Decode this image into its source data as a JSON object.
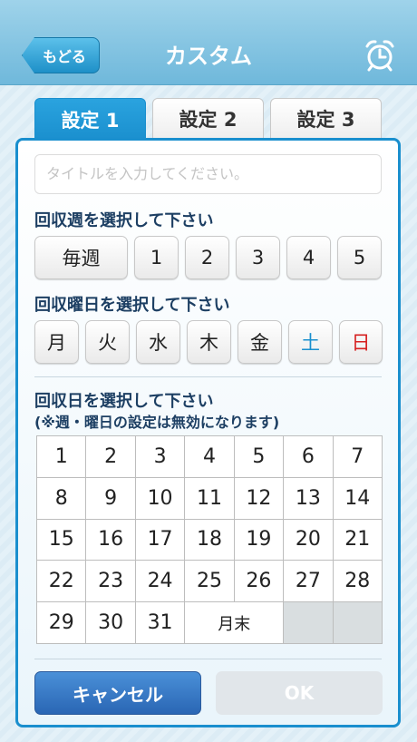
{
  "header": {
    "back_label": "もどる",
    "title": "カスタム",
    "alarm_icon": "alarm-clock-icon"
  },
  "tabs": [
    {
      "label": "設定 1",
      "active": true
    },
    {
      "label": "設定 2",
      "active": false
    },
    {
      "label": "設定 3",
      "active": false
    }
  ],
  "title_input": {
    "placeholder": "タイトルを入力してください。",
    "value": ""
  },
  "week_section": {
    "label": "回収週を選択して下さい",
    "options": [
      "毎週",
      "1",
      "2",
      "3",
      "4",
      "5"
    ]
  },
  "weekday_section": {
    "label": "回収曜日を選択して下さい",
    "options": [
      "月",
      "火",
      "水",
      "木",
      "金",
      "土",
      "日"
    ],
    "colors": {
      "default": "#222222",
      "saturday": "#1a8fce",
      "sunday": "#d62020"
    }
  },
  "day_section": {
    "label": "回収日を選択して下さい",
    "note": "(※週・曜日の設定は無効になります)",
    "days": [
      "1",
      "2",
      "3",
      "4",
      "5",
      "6",
      "7",
      "8",
      "9",
      "10",
      "11",
      "12",
      "13",
      "14",
      "15",
      "16",
      "17",
      "18",
      "19",
      "20",
      "21",
      "22",
      "23",
      "24",
      "25",
      "26",
      "27",
      "28",
      "29",
      "30",
      "31"
    ],
    "month_end_label": "月末"
  },
  "footer": {
    "cancel_label": "キャンセル",
    "ok_label": "OK"
  },
  "colors": {
    "accent": "#1a8fce",
    "header": "#7cc0e0",
    "cancel": "#3a7bc8"
  }
}
